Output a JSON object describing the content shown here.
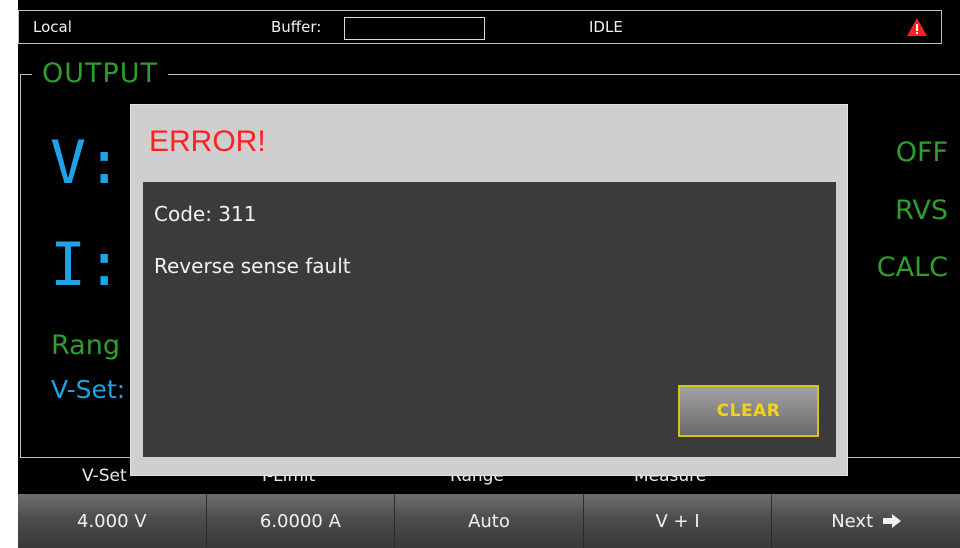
{
  "status": {
    "mode": "Local",
    "buffer_label": "Buffer:",
    "state": "IDLE",
    "warning_color": "#ff2020"
  },
  "output": {
    "title": "OUTPUT",
    "v_label": "V:",
    "i_label": "I:",
    "range_label": "Rang",
    "vset_label": "V-Set:",
    "indicators": [
      "OFF",
      "RVS",
      "CALC"
    ]
  },
  "softkeys": {
    "labels": [
      "V-Set",
      "I-Limit",
      "Range",
      "Measure"
    ],
    "values": [
      "4.000 V",
      "6.0000 A",
      "Auto",
      "V + I",
      "Next"
    ]
  },
  "dialog": {
    "title": "ERROR!",
    "code": "Code: 311",
    "message": "Reverse sense fault",
    "clear_label": "CLEAR"
  },
  "colors": {
    "accent_green": "#2f9e2f",
    "accent_blue": "#1ea3e6",
    "clear_yellow": "#f3d21c"
  }
}
